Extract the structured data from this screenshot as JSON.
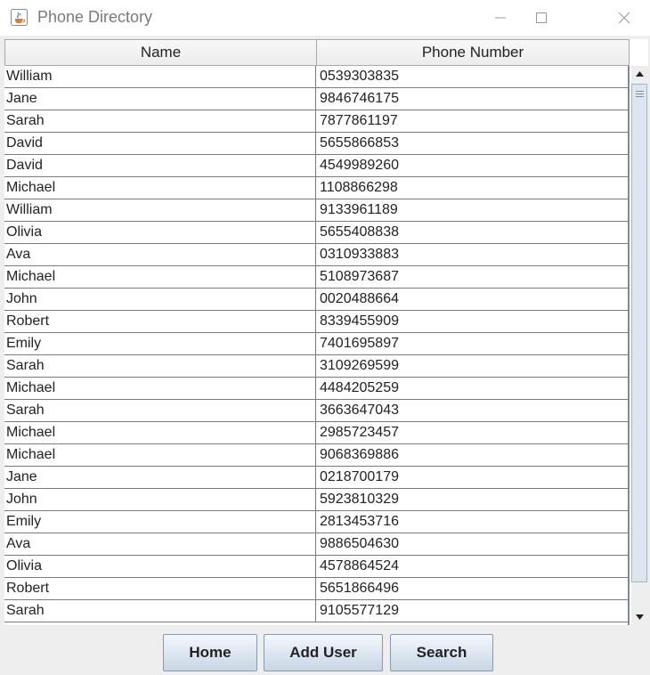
{
  "window": {
    "title": "Phone Directory"
  },
  "table": {
    "columns": [
      "Name",
      "Phone Number"
    ],
    "rows": [
      [
        "William",
        "0539303835"
      ],
      [
        "Jane",
        "9846746175"
      ],
      [
        "Sarah",
        "7877861197"
      ],
      [
        "David",
        "5655866853"
      ],
      [
        "David",
        "4549989260"
      ],
      [
        "Michael",
        "1108866298"
      ],
      [
        "William",
        "9133961189"
      ],
      [
        "Olivia",
        "5655408838"
      ],
      [
        "Ava",
        "0310933883"
      ],
      [
        "Michael",
        "5108973687"
      ],
      [
        "John",
        "0020488664"
      ],
      [
        "Robert",
        "8339455909"
      ],
      [
        "Emily",
        "7401695897"
      ],
      [
        "Sarah",
        "3109269599"
      ],
      [
        "Michael",
        "4484205259"
      ],
      [
        "Sarah",
        "3663647043"
      ],
      [
        "Michael",
        "2985723457"
      ],
      [
        "Michael",
        "9068369886"
      ],
      [
        "Jane",
        "0218700179"
      ],
      [
        "John",
        "5923810329"
      ],
      [
        "Emily",
        "2813453716"
      ],
      [
        "Ava",
        "9886504630"
      ],
      [
        "Olivia",
        "4578864524"
      ],
      [
        "Robert",
        "5651866496"
      ],
      [
        "Sarah",
        "9105577129"
      ]
    ]
  },
  "buttons": {
    "home": "Home",
    "add_user": "Add User",
    "search": "Search"
  },
  "icons": {
    "app": "java-cup-icon",
    "minimize": "minimize-icon",
    "maximize": "maximize-icon",
    "close": "close-icon",
    "scroll_up": "arrow-up-icon",
    "scroll_down": "arrow-down-icon"
  },
  "colors": {
    "titlebar": "#ffffff",
    "window_bg": "#eeeeee",
    "button_gradient_top": "#f4f8fc",
    "button_gradient_bottom": "#c9d6e5"
  }
}
